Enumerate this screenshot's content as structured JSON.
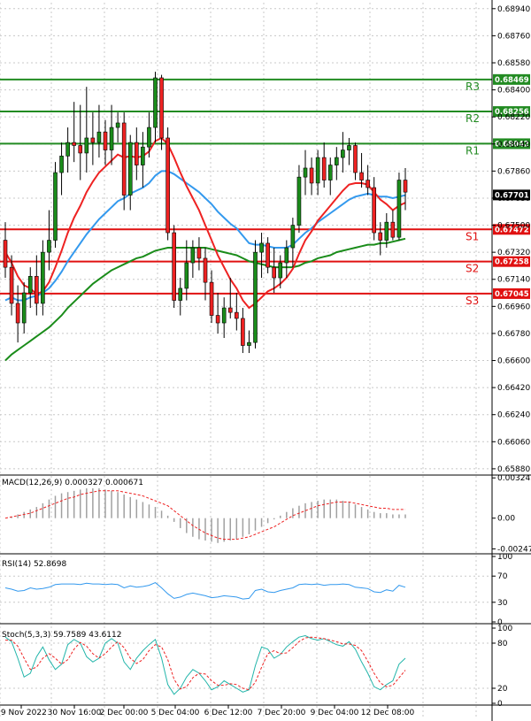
{
  "chart_data": {
    "type": "candlestick",
    "symbol_scale": {
      "min": 0.6585,
      "max": 0.6898
    },
    "price_ticks": [
      "0.68940",
      "0.68760",
      "0.68580",
      "0.68400",
      "0.68220",
      "0.68040",
      "0.67860",
      "0.67680",
      "0.67500",
      "0.67320",
      "0.67140",
      "0.66960",
      "0.66780",
      "0.66600",
      "0.66420",
      "0.66240",
      "0.66060",
      "0.65880"
    ],
    "time_labels": [
      "29 Nov 2022",
      "30 Nov 16:00",
      "2 Dec 00:00",
      "5 Dec 04:00",
      "6 Dec 12:00",
      "7 Dec 20:00",
      "9 Dec 04:00",
      "12 Dec 08:00"
    ],
    "levels": [
      {
        "name": "R3",
        "value": 0.68469,
        "label": "0.68469",
        "color": "#228b22"
      },
      {
        "name": "R2",
        "value": 0.68256,
        "label": "0.68256",
        "color": "#228b22"
      },
      {
        "name": "R1",
        "value": 0.68042,
        "label": "0.68042",
        "color": "#228b22"
      },
      {
        "name": "S1",
        "value": 0.67472,
        "label": "0.67472",
        "color": "#e01010"
      },
      {
        "name": "S2",
        "value": 0.67258,
        "label": "0.67258",
        "color": "#e01010"
      },
      {
        "name": "S3",
        "value": 0.67045,
        "label": "0.67045",
        "color": "#e01010"
      }
    ],
    "current_price": {
      "value": 0.67701,
      "label": "0.67701"
    },
    "candles": [
      {
        "o": 0.674,
        "h": 0.6752,
        "l": 0.6715,
        "c": 0.6722
      },
      {
        "o": 0.6722,
        "h": 0.673,
        "l": 0.669,
        "c": 0.6698
      },
      {
        "o": 0.6698,
        "h": 0.671,
        "l": 0.6672,
        "c": 0.6685
      },
      {
        "o": 0.6685,
        "h": 0.6712,
        "l": 0.6678,
        "c": 0.6705
      },
      {
        "o": 0.6705,
        "h": 0.6722,
        "l": 0.6695,
        "c": 0.6716
      },
      {
        "o": 0.6716,
        "h": 0.673,
        "l": 0.669,
        "c": 0.6698
      },
      {
        "o": 0.6698,
        "h": 0.674,
        "l": 0.669,
        "c": 0.6732
      },
      {
        "o": 0.6732,
        "h": 0.676,
        "l": 0.672,
        "c": 0.674
      },
      {
        "o": 0.674,
        "h": 0.6792,
        "l": 0.6735,
        "c": 0.6785
      },
      {
        "o": 0.6785,
        "h": 0.6805,
        "l": 0.677,
        "c": 0.6796
      },
      {
        "o": 0.6796,
        "h": 0.6815,
        "l": 0.6785,
        "c": 0.6805
      },
      {
        "o": 0.6805,
        "h": 0.6832,
        "l": 0.6792,
        "c": 0.6803
      },
      {
        "o": 0.6803,
        "h": 0.683,
        "l": 0.678,
        "c": 0.6798
      },
      {
        "o": 0.6798,
        "h": 0.6842,
        "l": 0.6785,
        "c": 0.6808
      },
      {
        "o": 0.6808,
        "h": 0.6825,
        "l": 0.679,
        "c": 0.6805
      },
      {
        "o": 0.6805,
        "h": 0.683,
        "l": 0.6795,
        "c": 0.6812
      },
      {
        "o": 0.6812,
        "h": 0.682,
        "l": 0.679,
        "c": 0.68
      },
      {
        "o": 0.68,
        "h": 0.683,
        "l": 0.679,
        "c": 0.6815
      },
      {
        "o": 0.6815,
        "h": 0.6825,
        "l": 0.6805,
        "c": 0.6818
      },
      {
        "o": 0.6818,
        "h": 0.6825,
        "l": 0.676,
        "c": 0.677
      },
      {
        "o": 0.677,
        "h": 0.681,
        "l": 0.676,
        "c": 0.6805
      },
      {
        "o": 0.6805,
        "h": 0.6815,
        "l": 0.678,
        "c": 0.679
      },
      {
        "o": 0.679,
        "h": 0.6812,
        "l": 0.6775,
        "c": 0.6802
      },
      {
        "o": 0.6802,
        "h": 0.6825,
        "l": 0.6795,
        "c": 0.6815
      },
      {
        "o": 0.6815,
        "h": 0.6852,
        "l": 0.6805,
        "c": 0.6848
      },
      {
        "o": 0.6848,
        "h": 0.685,
        "l": 0.68,
        "c": 0.6808
      },
      {
        "o": 0.6808,
        "h": 0.6815,
        "l": 0.674,
        "c": 0.6745
      },
      {
        "o": 0.6745,
        "h": 0.675,
        "l": 0.6695,
        "c": 0.67
      },
      {
        "o": 0.67,
        "h": 0.6715,
        "l": 0.669,
        "c": 0.6708
      },
      {
        "o": 0.6708,
        "h": 0.674,
        "l": 0.67,
        "c": 0.6725
      },
      {
        "o": 0.6725,
        "h": 0.674,
        "l": 0.6715,
        "c": 0.6735
      },
      {
        "o": 0.6735,
        "h": 0.6742,
        "l": 0.672,
        "c": 0.6728
      },
      {
        "o": 0.6728,
        "h": 0.6735,
        "l": 0.67,
        "c": 0.6712
      },
      {
        "o": 0.6712,
        "h": 0.672,
        "l": 0.6685,
        "c": 0.669
      },
      {
        "o": 0.669,
        "h": 0.6705,
        "l": 0.6678,
        "c": 0.6685
      },
      {
        "o": 0.6685,
        "h": 0.6702,
        "l": 0.6675,
        "c": 0.6695
      },
      {
        "o": 0.6695,
        "h": 0.6715,
        "l": 0.6688,
        "c": 0.6692
      },
      {
        "o": 0.6692,
        "h": 0.6705,
        "l": 0.668,
        "c": 0.6688
      },
      {
        "o": 0.6688,
        "h": 0.6695,
        "l": 0.6665,
        "c": 0.667
      },
      {
        "o": 0.667,
        "h": 0.668,
        "l": 0.6665,
        "c": 0.6672
      },
      {
        "o": 0.6672,
        "h": 0.674,
        "l": 0.6668,
        "c": 0.6732
      },
      {
        "o": 0.6732,
        "h": 0.6745,
        "l": 0.6715,
        "c": 0.6738
      },
      {
        "o": 0.6738,
        "h": 0.6742,
        "l": 0.6718,
        "c": 0.6722
      },
      {
        "o": 0.6722,
        "h": 0.6735,
        "l": 0.6705,
        "c": 0.6715
      },
      {
        "o": 0.6715,
        "h": 0.673,
        "l": 0.6708,
        "c": 0.6725
      },
      {
        "o": 0.6725,
        "h": 0.674,
        "l": 0.6715,
        "c": 0.6735
      },
      {
        "o": 0.6735,
        "h": 0.6755,
        "l": 0.6722,
        "c": 0.675
      },
      {
        "o": 0.675,
        "h": 0.679,
        "l": 0.6745,
        "c": 0.6782
      },
      {
        "o": 0.6782,
        "h": 0.68,
        "l": 0.677,
        "c": 0.6788
      },
      {
        "o": 0.6788,
        "h": 0.6795,
        "l": 0.677,
        "c": 0.6778
      },
      {
        "o": 0.6778,
        "h": 0.68,
        "l": 0.677,
        "c": 0.6795
      },
      {
        "o": 0.6795,
        "h": 0.6805,
        "l": 0.6775,
        "c": 0.678
      },
      {
        "o": 0.678,
        "h": 0.6795,
        "l": 0.677,
        "c": 0.679
      },
      {
        "o": 0.679,
        "h": 0.6802,
        "l": 0.678,
        "c": 0.6795
      },
      {
        "o": 0.6795,
        "h": 0.6812,
        "l": 0.6785,
        "c": 0.68
      },
      {
        "o": 0.68,
        "h": 0.6808,
        "l": 0.679,
        "c": 0.6803
      },
      {
        "o": 0.6803,
        "h": 0.6805,
        "l": 0.678,
        "c": 0.6785
      },
      {
        "o": 0.6785,
        "h": 0.6798,
        "l": 0.6775,
        "c": 0.678
      },
      {
        "o": 0.678,
        "h": 0.679,
        "l": 0.677,
        "c": 0.6775
      },
      {
        "o": 0.6775,
        "h": 0.6782,
        "l": 0.674,
        "c": 0.6745
      },
      {
        "o": 0.6745,
        "h": 0.6752,
        "l": 0.673,
        "c": 0.674
      },
      {
        "o": 0.674,
        "h": 0.6758,
        "l": 0.6735,
        "c": 0.6752
      },
      {
        "o": 0.6752,
        "h": 0.676,
        "l": 0.674,
        "c": 0.6742
      },
      {
        "o": 0.6742,
        "h": 0.6785,
        "l": 0.674,
        "c": 0.678
      },
      {
        "o": 0.678,
        "h": 0.6788,
        "l": 0.676,
        "c": 0.6772
      }
    ],
    "ma_fast_red": [
      0.6732,
      0.6725,
      0.6716,
      0.671,
      0.6708,
      0.6704,
      0.6706,
      0.6712,
      0.6722,
      0.6733,
      0.6745,
      0.6755,
      0.6763,
      0.6772,
      0.6779,
      0.6785,
      0.6789,
      0.6793,
      0.6797,
      0.6795,
      0.6796,
      0.6795,
      0.6796,
      0.6799,
      0.6806,
      0.6808,
      0.6804,
      0.6795,
      0.6785,
      0.6776,
      0.6768,
      0.676,
      0.675,
      0.674,
      0.673,
      0.6722,
      0.6714,
      0.6708,
      0.67,
      0.6695,
      0.6698,
      0.6702,
      0.6706,
      0.6708,
      0.6711,
      0.6715,
      0.6721,
      0.6731,
      0.674,
      0.6746,
      0.6753,
      0.6758,
      0.6763,
      0.6768,
      0.6773,
      0.6777,
      0.6778,
      0.6778,
      0.6777,
      0.6772,
      0.6767,
      0.6764,
      0.676,
      0.6763,
      0.6765
    ],
    "ma_mid_blue": [
      0.67,
      0.6702,
      0.67,
      0.67,
      0.6702,
      0.6703,
      0.6705,
      0.6708,
      0.6713,
      0.6719,
      0.6726,
      0.6732,
      0.6738,
      0.6744,
      0.6749,
      0.6754,
      0.6758,
      0.6762,
      0.6766,
      0.6768,
      0.6771,
      0.6773,
      0.6775,
      0.6778,
      0.6783,
      0.6786,
      0.6786,
      0.6784,
      0.6781,
      0.6778,
      0.6775,
      0.6772,
      0.6768,
      0.6764,
      0.6759,
      0.6755,
      0.6751,
      0.6748,
      0.6743,
      0.6738,
      0.6737,
      0.6737,
      0.6736,
      0.6735,
      0.6735,
      0.6735,
      0.6737,
      0.6741,
      0.6745,
      0.6748,
      0.6752,
      0.6755,
      0.6758,
      0.6761,
      0.6764,
      0.6767,
      0.6769,
      0.677,
      0.6771,
      0.677,
      0.6769,
      0.6769,
      0.6768,
      0.6769,
      0.677
    ],
    "ma_slow_green": [
      0.666,
      0.6664,
      0.6667,
      0.667,
      0.6673,
      0.6676,
      0.6679,
      0.6682,
      0.6686,
      0.669,
      0.6695,
      0.6699,
      0.6703,
      0.6707,
      0.6711,
      0.6714,
      0.6717,
      0.672,
      0.6722,
      0.6724,
      0.6726,
      0.6728,
      0.6729,
      0.6731,
      0.6733,
      0.6734,
      0.6735,
      0.6735,
      0.6735,
      0.6735,
      0.6735,
      0.6735,
      0.6735,
      0.6734,
      0.6733,
      0.6732,
      0.6731,
      0.673,
      0.6728,
      0.6726,
      0.6725,
      0.6724,
      0.6723,
      0.6722,
      0.6722,
      0.6722,
      0.6722,
      0.6723,
      0.6725,
      0.6726,
      0.6728,
      0.6729,
      0.673,
      0.6732,
      0.6733,
      0.6734,
      0.6735,
      0.6736,
      0.6737,
      0.6737,
      0.6738,
      0.6738,
      0.6739,
      0.674,
      0.6741
    ],
    "macd": {
      "label": "MACD(12,26,9) 0.000327 0.000671",
      "ticks": [
        "0.003245",
        "0.00",
        "-0.002475"
      ],
      "range": [
        -0.0028,
        0.0034
      ],
      "hist": [
        0.0,
        0.0001,
        0.0003,
        0.0005,
        0.0007,
        0.0009,
        0.0012,
        0.0015,
        0.0018,
        0.002,
        0.0021,
        0.0022,
        0.0023,
        0.0024,
        0.0024,
        0.0024,
        0.0023,
        0.0022,
        0.0021,
        0.0019,
        0.0017,
        0.0015,
        0.0013,
        0.0011,
        0.0009,
        0.0006,
        0.0002,
        -0.0003,
        -0.0008,
        -0.0012,
        -0.0015,
        -0.0017,
        -0.0018,
        -0.0019,
        -0.002,
        -0.0019,
        -0.0018,
        -0.0017,
        -0.0015,
        -0.0013,
        -0.001,
        -0.0007,
        -0.0004,
        -0.0001,
        0.0002,
        0.0005,
        0.0008,
        0.001,
        0.0012,
        0.0013,
        0.0014,
        0.0015,
        0.0015,
        0.0015,
        0.0014,
        0.0013,
        0.0011,
        0.0009,
        0.0007,
        0.0005,
        0.0004,
        0.0004,
        0.0003,
        0.0003,
        0.0003
      ],
      "signal": [
        0.0,
        0.0001,
        0.0002,
        0.0003,
        0.0004,
        0.0006,
        0.0008,
        0.001,
        0.0012,
        0.0014,
        0.0016,
        0.0017,
        0.0019,
        0.002,
        0.0021,
        0.0022,
        0.0022,
        0.0022,
        0.0022,
        0.0021,
        0.002,
        0.0019,
        0.0018,
        0.0016,
        0.0014,
        0.0012,
        0.001,
        0.0006,
        0.0002,
        -0.0002,
        -0.0006,
        -0.0009,
        -0.0012,
        -0.0014,
        -0.0016,
        -0.0017,
        -0.0017,
        -0.0017,
        -0.0016,
        -0.0015,
        -0.0013,
        -0.0011,
        -0.0009,
        -0.0007,
        -0.0004,
        -0.0001,
        0.0002,
        0.0004,
        0.0006,
        0.0008,
        0.001,
        0.0011,
        0.0012,
        0.0013,
        0.0013,
        0.0013,
        0.0012,
        0.0011,
        0.001,
        0.0009,
        0.0008,
        0.0008,
        0.0007,
        0.0007,
        0.0007
      ]
    },
    "rsi": {
      "label": "RSI(14) 52.8698",
      "ticks": [
        "100",
        "70",
        "30",
        "0"
      ],
      "values": [
        52,
        50,
        47,
        48,
        52,
        50,
        51,
        53,
        57,
        58,
        58,
        58,
        57,
        59,
        58,
        58,
        57,
        58,
        57,
        52,
        55,
        53,
        54,
        56,
        60,
        52,
        43,
        36,
        38,
        42,
        44,
        42,
        40,
        37,
        38,
        40,
        39,
        38,
        35,
        36,
        48,
        50,
        46,
        45,
        48,
        50,
        52,
        57,
        58,
        57,
        58,
        56,
        57,
        57,
        58,
        57,
        53,
        52,
        51,
        46,
        45,
        49,
        47,
        56,
        53
      ]
    },
    "stoch": {
      "label": "Stoch(5,3,3) 59.7589 43.6112",
      "ticks": [
        "100",
        "80",
        "20",
        "0"
      ],
      "k": [
        88,
        82,
        60,
        35,
        40,
        62,
        75,
        58,
        45,
        52,
        78,
        85,
        80,
        62,
        55,
        60,
        80,
        86,
        80,
        55,
        45,
        60,
        70,
        78,
        85,
        60,
        25,
        12,
        20,
        35,
        45,
        40,
        30,
        18,
        22,
        30,
        25,
        20,
        15,
        18,
        50,
        75,
        72,
        60,
        65,
        75,
        82,
        88,
        90,
        86,
        84,
        86,
        82,
        78,
        76,
        82,
        72,
        55,
        40,
        22,
        18,
        25,
        30,
        52,
        60
      ],
      "d": [
        84,
        84,
        76,
        60,
        45,
        48,
        60,
        66,
        60,
        52,
        58,
        72,
        81,
        76,
        66,
        60,
        66,
        75,
        82,
        74,
        60,
        53,
        58,
        70,
        78,
        75,
        58,
        32,
        19,
        22,
        34,
        40,
        39,
        30,
        24,
        24,
        26,
        25,
        20,
        18,
        28,
        48,
        66,
        70,
        66,
        67,
        74,
        82,
        87,
        88,
        87,
        86,
        84,
        82,
        79,
        79,
        77,
        70,
        56,
        40,
        27,
        22,
        24,
        34,
        44
      ]
    }
  }
}
